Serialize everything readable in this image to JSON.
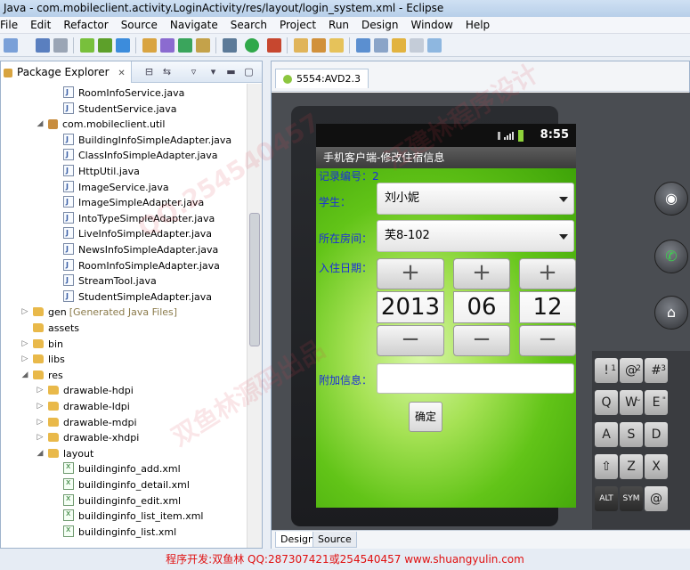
{
  "window_title": "Java - com.mobileclient.activity.LoginActivity/res/layout/login_system.xml - Eclipse",
  "menu": [
    "File",
    "Edit",
    "Refactor",
    "Source",
    "Navigate",
    "Search",
    "Project",
    "Run",
    "Design",
    "Window",
    "Help"
  ],
  "package_explorer": {
    "tab_label": "Package Explorer",
    "items": [
      {
        "label": "RoomInfoService.java",
        "type": "java",
        "depth": 4
      },
      {
        "label": "StudentService.java",
        "type": "java",
        "depth": 4
      },
      {
        "label": "com.mobileclient.util",
        "type": "package",
        "depth": 3,
        "expanded": true
      },
      {
        "label": "BuildingInfoSimpleAdapter.java",
        "type": "java",
        "depth": 4
      },
      {
        "label": "ClassInfoSimpleAdapter.java",
        "type": "java",
        "depth": 4
      },
      {
        "label": "HttpUtil.java",
        "type": "java",
        "depth": 4
      },
      {
        "label": "ImageService.java",
        "type": "java",
        "depth": 4
      },
      {
        "label": "ImageSimpleAdapter.java",
        "type": "java",
        "depth": 4
      },
      {
        "label": "IntoTypeSimpleAdapter.java",
        "type": "java",
        "depth": 4
      },
      {
        "label": "LiveInfoSimpleAdapter.java",
        "type": "java",
        "depth": 4
      },
      {
        "label": "NewsInfoSimpleAdapter.java",
        "type": "java",
        "depth": 4
      },
      {
        "label": "RoomInfoSimpleAdapter.java",
        "type": "java",
        "depth": 4
      },
      {
        "label": "StreamTool.java",
        "type": "java",
        "depth": 4
      },
      {
        "label": "StudentSimpleAdapter.java",
        "type": "java",
        "depth": 4
      },
      {
        "label": "gen",
        "suffix": "[Generated Java Files]",
        "type": "folder",
        "depth": 2,
        "expanded": false
      },
      {
        "label": "assets",
        "type": "folder",
        "depth": 2
      },
      {
        "label": "bin",
        "type": "folder",
        "depth": 2,
        "expanded": false
      },
      {
        "label": "libs",
        "type": "folder",
        "depth": 2,
        "expanded": false
      },
      {
        "label": "res",
        "type": "folder",
        "depth": 2,
        "expanded": true
      },
      {
        "label": "drawable-hdpi",
        "type": "folder",
        "depth": 3,
        "expanded": false
      },
      {
        "label": "drawable-ldpi",
        "type": "folder",
        "depth": 3,
        "expanded": false
      },
      {
        "label": "drawable-mdpi",
        "type": "folder",
        "depth": 3,
        "expanded": false
      },
      {
        "label": "drawable-xhdpi",
        "type": "folder",
        "depth": 3,
        "expanded": false
      },
      {
        "label": "layout",
        "type": "folder",
        "depth": 3,
        "expanded": true
      },
      {
        "label": "buildinginfo_add.xml",
        "type": "xml",
        "depth": 4
      },
      {
        "label": "buildinginfo_detail.xml",
        "type": "xml",
        "depth": 4
      },
      {
        "label": "buildinginfo_edit.xml",
        "type": "xml",
        "depth": 4
      },
      {
        "label": "buildinginfo_list_item.xml",
        "type": "xml",
        "depth": 4
      },
      {
        "label": "buildinginfo_list.xml",
        "type": "xml",
        "depth": 4
      }
    ]
  },
  "emulator": {
    "tab_label": "5554:AVD2.3",
    "clock": "8:55",
    "app_title": "手机客户端-修改住宿信息",
    "record_label": "记录编号：2",
    "student_label": "学生：",
    "student_value": "刘小妮",
    "room_label": "所在房间：",
    "room_value": "芙8-102",
    "date_label": "入住日期：",
    "date_year": "2013",
    "date_month": "06",
    "date_day": "12",
    "plus": "+",
    "minus": "−",
    "extra_label": "附加信息：",
    "extra_value": "",
    "confirm": "确定"
  },
  "keyboard": {
    "rows": [
      [
        {
          "k": "!",
          "s": "1"
        },
        {
          "k": "@",
          "s": "2"
        },
        {
          "k": "#",
          "s": "3"
        }
      ],
      [
        {
          "k": "Q"
        },
        {
          "k": "W",
          "s": "~"
        },
        {
          "k": "E",
          "s": "\""
        }
      ],
      [
        {
          "k": "A"
        },
        {
          "k": "S"
        },
        {
          "k": "D"
        }
      ],
      [
        {
          "k": "⇧"
        },
        {
          "k": "Z"
        },
        {
          "k": "X"
        }
      ],
      [
        {
          "k": "ALT"
        },
        {
          "k": "SYM"
        },
        {
          "k": "@"
        }
      ]
    ]
  },
  "editor_tabs": {
    "design": "Design",
    "source": "Source"
  },
  "watermarks": [
    "QQ:254540457",
    "双鱼林源码出品",
    "汪建林程序设计"
  ],
  "footer": "程序开发:双鱼林 QQ:287307421或254540457 www.shuangyulin.com"
}
